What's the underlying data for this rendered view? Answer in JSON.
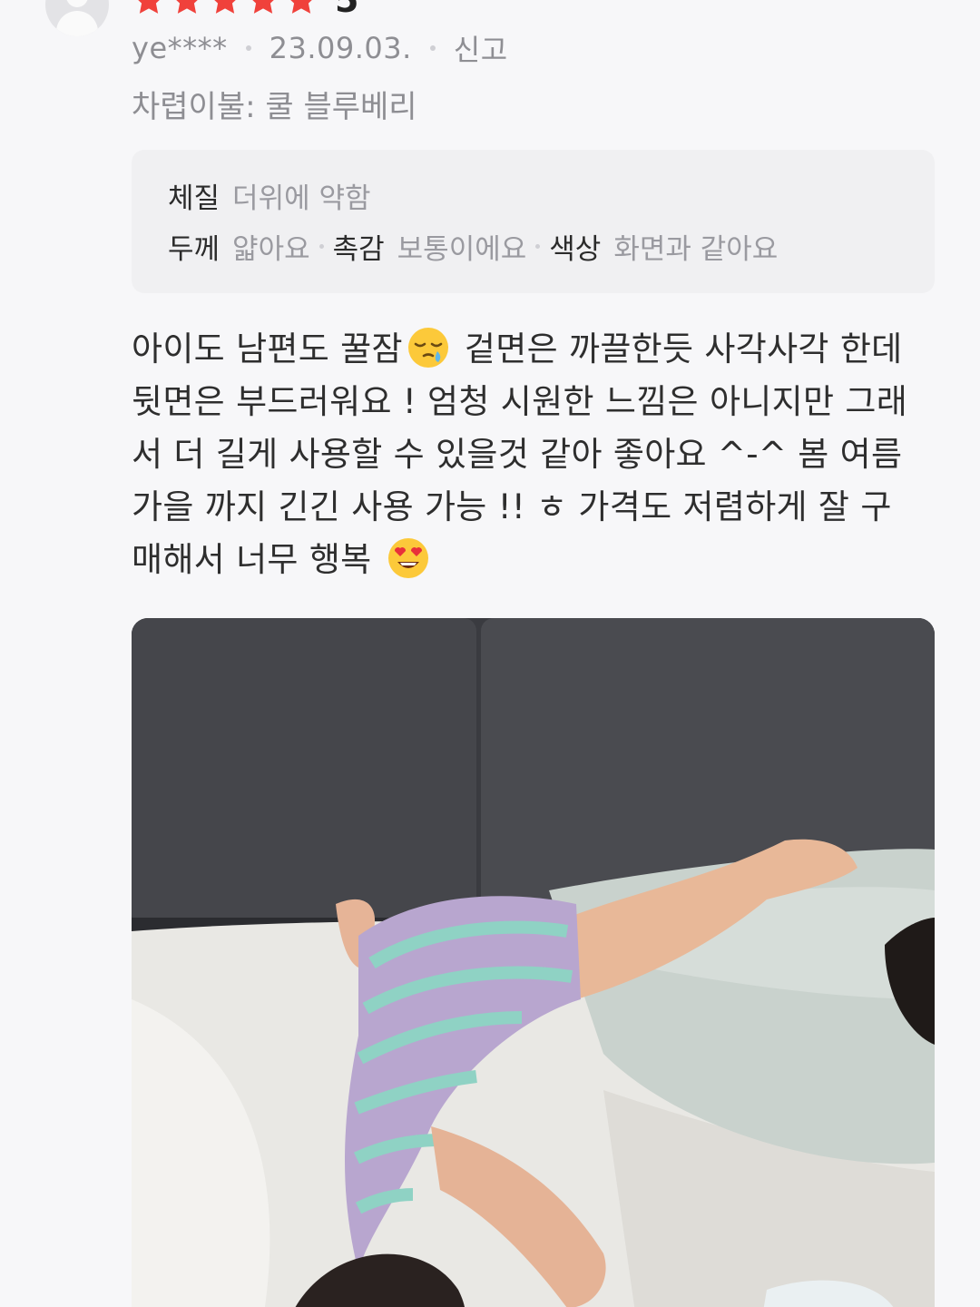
{
  "review": {
    "rating": "5",
    "user": "ye****",
    "date": "23.09.03.",
    "report_label": "신고",
    "option": "차렵이불: 쿨 블루베리",
    "attributes": {
      "row1": [
        {
          "key": "체질",
          "value": "더위에 약함"
        }
      ],
      "row2": [
        {
          "key": "두께",
          "value": "얇아요"
        },
        {
          "key": "촉감",
          "value": "보통이에요"
        },
        {
          "key": "색상",
          "value": "화면과 같아요"
        }
      ]
    },
    "text_part1": "아이도 남편도 꿀잠",
    "emoji1": "sleepy-face-emoji",
    "text_part2": " 겉면은 까끌한듯 사각사각 한데\n뒷면은 부드러워요 ! 엄청 시원한 느낌은 아니지만 그래\n서 더 길게 사용할 수 있을것 같아 좋아요 ^-^ 봄 여름\n가을 까지 긴긴 사용 가능 !! ㅎ 가격도 저렴하게 잘 구\n매해서 너무 행복 ",
    "emoji2": "heart-eyes-emoji",
    "photo": "child-sleeping-on-bed-photo"
  },
  "colors": {
    "star": "#f0413b",
    "background": "#f7f7f9",
    "meta_text": "#8e8e93"
  }
}
